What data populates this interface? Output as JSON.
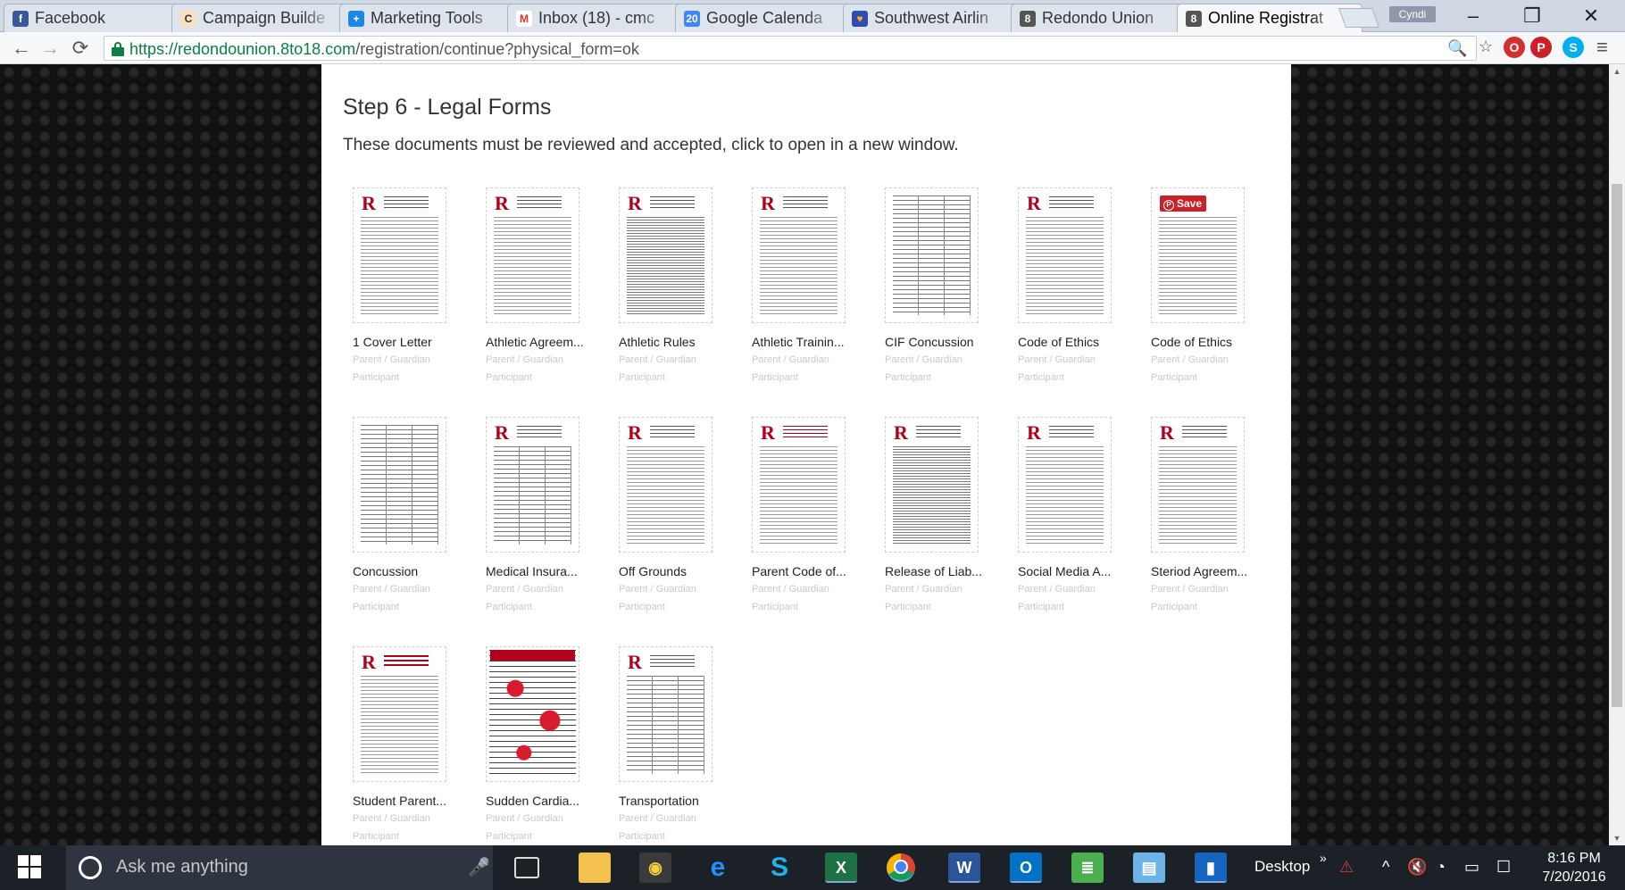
{
  "browser": {
    "tabs": [
      {
        "title": "Facebook",
        "icon": "f",
        "color": "#3b5998"
      },
      {
        "title": "Campaign Builde",
        "icon": "🐵",
        "color": "#f7e2c0"
      },
      {
        "title": "Marketing Tools",
        "icon": "✚",
        "color": "#1e88e5"
      },
      {
        "title": "Inbox (18) - cmc",
        "icon": "M",
        "color": "#ffffff"
      },
      {
        "title": "Google Calenda",
        "icon": "20",
        "color": "#4285f4"
      },
      {
        "title": "Southwest Airlin",
        "icon": "♥",
        "color": "#e33"
      },
      {
        "title": "Redondo Union",
        "icon": "8",
        "color": "#555555"
      },
      {
        "title": "Online Registrat",
        "icon": "8",
        "color": "#555555"
      }
    ],
    "profile_name": "Cyndi",
    "url_host": "https://redondounion.8to18.com",
    "url_path": "/registration/continue?physical_form=ok"
  },
  "page": {
    "step_title": "Step 6 - Legal Forms",
    "step_desc": "These documents must be reviewed and accepted, click to open in a new window.",
    "save_label": "Save",
    "documents": [
      {
        "title": "1 Cover Letter",
        "sub1": "Parent / Guardian",
        "sub2": "Participant"
      },
      {
        "title": "Athletic Agreem...",
        "sub1": "Parent / Guardian",
        "sub2": "Participant"
      },
      {
        "title": "Athletic Rules",
        "sub1": "Parent / Guardian",
        "sub2": "Participant"
      },
      {
        "title": "Athletic Trainin...",
        "sub1": "Parent / Guardian",
        "sub2": "Participant"
      },
      {
        "title": "CIF Concussion",
        "sub1": "Parent / Guardian",
        "sub2": "Participant"
      },
      {
        "title": "Code of Ethics",
        "sub1": "Parent / Guardian",
        "sub2": "Participant"
      },
      {
        "title": "Code of Ethics",
        "sub1": "Parent / Guardian",
        "sub2": "Participant"
      },
      {
        "title": "Concussion",
        "sub1": "Parent / Guardian",
        "sub2": "Participant"
      },
      {
        "title": "Medical Insura...",
        "sub1": "Parent / Guardian",
        "sub2": "Participant"
      },
      {
        "title": "Off Grounds",
        "sub1": "Parent / Guardian",
        "sub2": "Participant"
      },
      {
        "title": "Parent Code of...",
        "sub1": "Parent / Guardian",
        "sub2": "Participant"
      },
      {
        "title": "Release of Liab...",
        "sub1": "Parent / Guardian",
        "sub2": "Participant"
      },
      {
        "title": "Social Media A...",
        "sub1": "Parent / Guardian",
        "sub2": "Participant"
      },
      {
        "title": "Steriod Agreem...",
        "sub1": "Parent / Guardian",
        "sub2": "Participant"
      },
      {
        "title": "Student Parent...",
        "sub1": "Parent / Guardian",
        "sub2": "Participant"
      },
      {
        "title": "Sudden Cardia...",
        "sub1": "Parent / Guardian",
        "sub2": "Participant"
      },
      {
        "title": "Transportation",
        "sub1": "Parent / Guardian",
        "sub2": "Participant"
      }
    ]
  },
  "taskbar": {
    "search_placeholder": "Ask me anything",
    "desktop_label": "Desktop",
    "time": "8:16 PM",
    "date": "7/20/2016"
  },
  "colors": {
    "accent_red": "#b3001b",
    "url_green": "#0b8043",
    "taskbar": "#1c2128"
  }
}
